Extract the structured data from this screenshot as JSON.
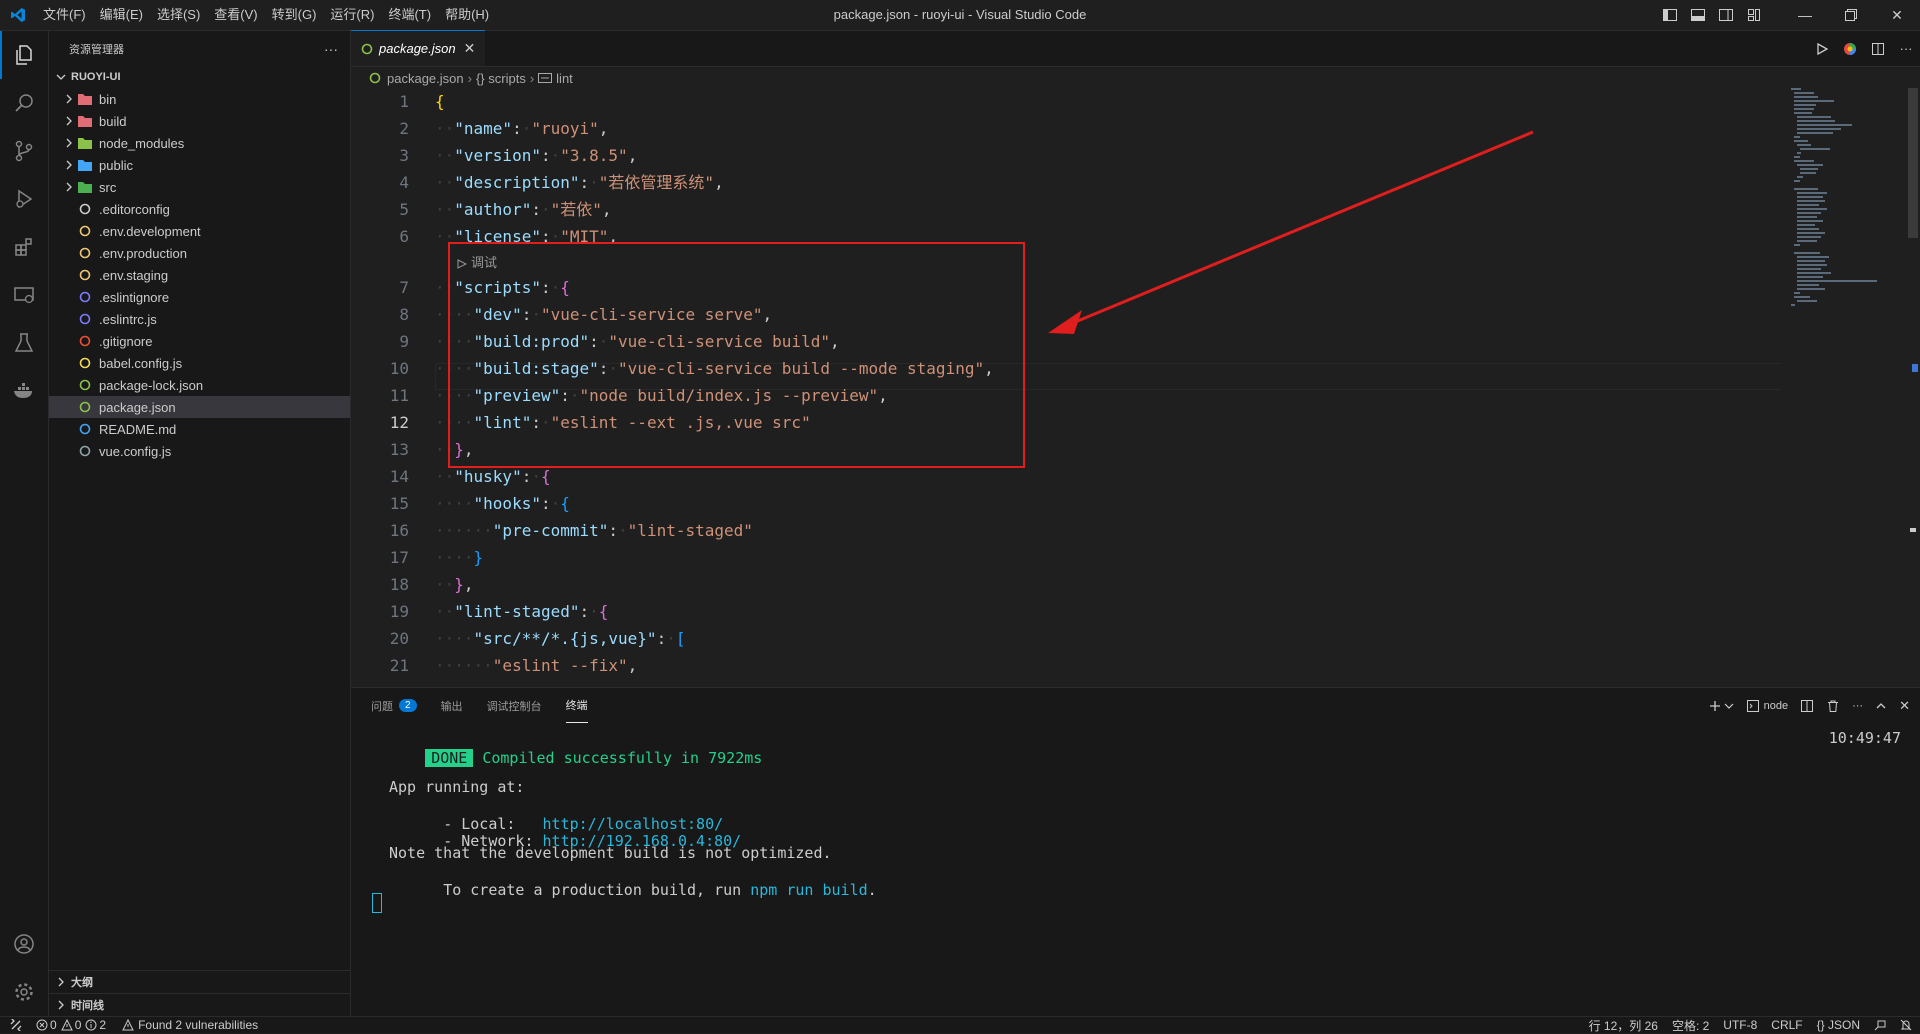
{
  "window": {
    "title": "package.json - ruoyi-ui - Visual Studio Code",
    "menu": [
      "文件(F)",
      "编辑(E)",
      "选择(S)",
      "查看(V)",
      "转到(G)",
      "运行(R)",
      "终端(T)",
      "帮助(H)"
    ]
  },
  "sidebar": {
    "header": "资源管理器",
    "more": "···",
    "root": "RUOYI-UI",
    "items": [
      {
        "label": "bin",
        "kind": "folder",
        "color": "#e06c75"
      },
      {
        "label": "build",
        "kind": "folder",
        "color": "#e06c75"
      },
      {
        "label": "node_modules",
        "kind": "folder",
        "color": "#8bc34a"
      },
      {
        "label": "public",
        "kind": "folder",
        "color": "#42a5f5"
      },
      {
        "label": "src",
        "kind": "folder",
        "color": "#4caf50"
      },
      {
        "label": ".editorconfig",
        "kind": "file",
        "color": "#cccccc"
      },
      {
        "label": ".env.development",
        "kind": "file",
        "color": "#f0c674"
      },
      {
        "label": ".env.production",
        "kind": "file",
        "color": "#f0c674"
      },
      {
        "label": ".env.staging",
        "kind": "file",
        "color": "#f0c674"
      },
      {
        "label": ".eslintignore",
        "kind": "file",
        "color": "#7c7cff"
      },
      {
        "label": ".eslintrc.js",
        "kind": "file",
        "color": "#7c7cff"
      },
      {
        "label": ".gitignore",
        "kind": "file",
        "color": "#f05033"
      },
      {
        "label": "babel.config.js",
        "kind": "file",
        "color": "#f5da55"
      },
      {
        "label": "package-lock.json",
        "kind": "file",
        "color": "#8bc34a"
      },
      {
        "label": "package.json",
        "kind": "file",
        "color": "#8bc34a",
        "selected": true
      },
      {
        "label": "README.md",
        "kind": "file",
        "color": "#42a5f5"
      },
      {
        "label": "vue.config.js",
        "kind": "file",
        "color": "#90a4ae"
      }
    ],
    "outline": "大纲",
    "timeline": "时间线"
  },
  "editor": {
    "tab_label": "package.json",
    "breadcrumb": [
      "package.json",
      "{} scripts",
      "lint"
    ],
    "codelens": "调试",
    "lines": [
      {
        "n": "1",
        "text": "{"
      },
      {
        "n": "2",
        "text": "  \"name\": \"ruoyi\","
      },
      {
        "n": "3",
        "text": "  \"version\": \"3.8.5\","
      },
      {
        "n": "4",
        "text": "  \"description\": \"若依管理系统\","
      },
      {
        "n": "5",
        "text": "  \"author\": \"若依\","
      },
      {
        "n": "6",
        "text": "  \"license\": \"MIT\","
      },
      {
        "n": "7",
        "text": "  \"scripts\": {"
      },
      {
        "n": "8",
        "text": "    \"dev\": \"vue-cli-service serve\","
      },
      {
        "n": "9",
        "text": "    \"build:prod\": \"vue-cli-service build\","
      },
      {
        "n": "10",
        "text": "    \"build:stage\": \"vue-cli-service build --mode staging\","
      },
      {
        "n": "11",
        "text": "    \"preview\": \"node build/index.js --preview\","
      },
      {
        "n": "12",
        "text": "    \"lint\": \"eslint --ext .js,.vue src\""
      },
      {
        "n": "13",
        "text": "  },"
      },
      {
        "n": "14",
        "text": "  \"husky\": {"
      },
      {
        "n": "15",
        "text": "    \"hooks\": {"
      },
      {
        "n": "16",
        "text": "      \"pre-commit\": \"lint-staged\""
      },
      {
        "n": "17",
        "text": "    }"
      },
      {
        "n": "18",
        "text": "  },"
      },
      {
        "n": "19",
        "text": "  \"lint-staged\": {"
      },
      {
        "n": "20",
        "text": "    \"src/**/*.{js,vue}\": ["
      },
      {
        "n": "21",
        "text": "      \"eslint --fix\","
      }
    ]
  },
  "panel": {
    "tabs": [
      "问题",
      "输出",
      "调试控制台",
      "终端"
    ],
    "problems_count": "2",
    "terminal_name": "node",
    "terminal": {
      "done_badge": "DONE",
      "compiled": "Compiled successfully in 7922ms",
      "time": "10:49:47",
      "running": "App running at:",
      "local_label": "- Local:   ",
      "local_url": "http://localhost:80/",
      "network_label": "- Network: ",
      "network_url": "http://192.168.0.4:80/",
      "note": "Note that the development build is not optimized.",
      "prod_prefix": "To create a production build, run ",
      "prod_cmd": "npm run build",
      "prod_suffix": "."
    }
  },
  "statusbar": {
    "errors": "0",
    "warnings": "0",
    "infos": "2",
    "vuln": "Found 2 vulnerabilities",
    "position": "行 12，列 26",
    "spaces": "空格: 2",
    "encoding": "UTF-8",
    "eol": "CRLF",
    "language": "{} JSON"
  }
}
